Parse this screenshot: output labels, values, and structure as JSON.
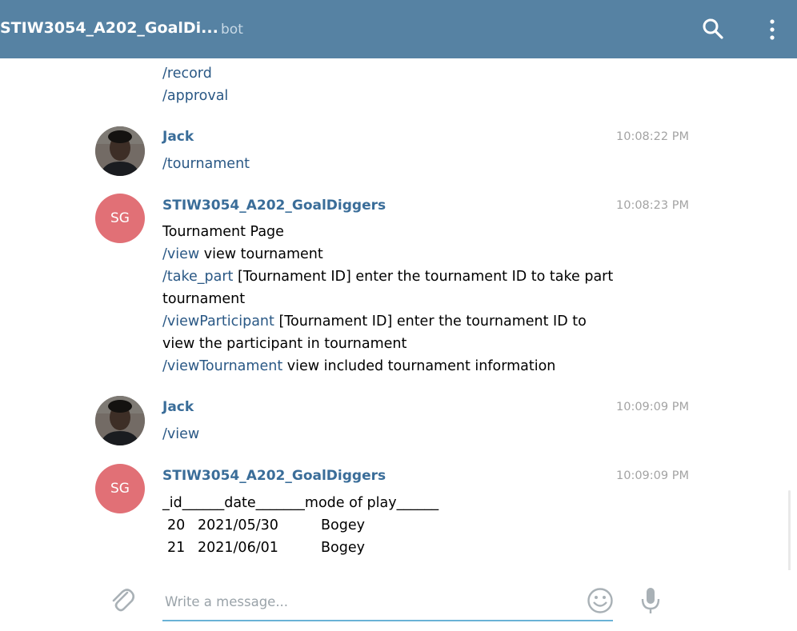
{
  "header": {
    "title": "STIW3054_A202_GoalDi...",
    "subtitle": "bot",
    "search_icon": "search-icon",
    "menu_icon": "more-vertical-icon"
  },
  "messages": {
    "top_lines": [
      "/record",
      "/approval"
    ],
    "m1": {
      "sender": "Jack",
      "time": "10:08:22 PM",
      "text": "/tournament"
    },
    "m2": {
      "sender": "STIW3054_A202_GoalDiggers",
      "time": "10:08:23 PM",
      "avatar_initials": "SG",
      "line1": "Tournament Page",
      "l2_cmd": "/view",
      "l2_text": " view tournament",
      "l3_cmd": "/take_part",
      "l3_text": " [Tournament ID] enter the tournament ID to take part",
      "l4_text": "tournament",
      "l5_cmd": "/viewParticipant",
      "l5_text": " [Tournament ID] enter the tournament ID to",
      "l6_text": "view the participant in tournament",
      "l7_cmd": "/viewTournament",
      "l7_text": " view included tournament information"
    },
    "m3": {
      "sender": "Jack",
      "time": "10:09:09 PM",
      "text": "/view"
    },
    "m4": {
      "sender": "STIW3054_A202_GoalDiggers",
      "time": "10:09:09 PM",
      "avatar_initials": "SG",
      "header_line": "_id______date_______mode of play______",
      "rows": [
        {
          "id": "20",
          "date": "2021/05/30",
          "mode": "Bogey"
        },
        {
          "id": "21",
          "date": "2021/06/01",
          "mode": "Bogey"
        }
      ]
    }
  },
  "composer": {
    "placeholder": "Write a message...",
    "attach_icon": "paperclip-icon",
    "emoji_icon": "emoji-icon",
    "mic_icon": "microphone-icon"
  },
  "colors": {
    "header_bg": "#5682a3",
    "link": "#2a5885",
    "sender": "#3a6d99",
    "avatar_sg": "#e17076",
    "input_underline": "#6ab2d6"
  }
}
